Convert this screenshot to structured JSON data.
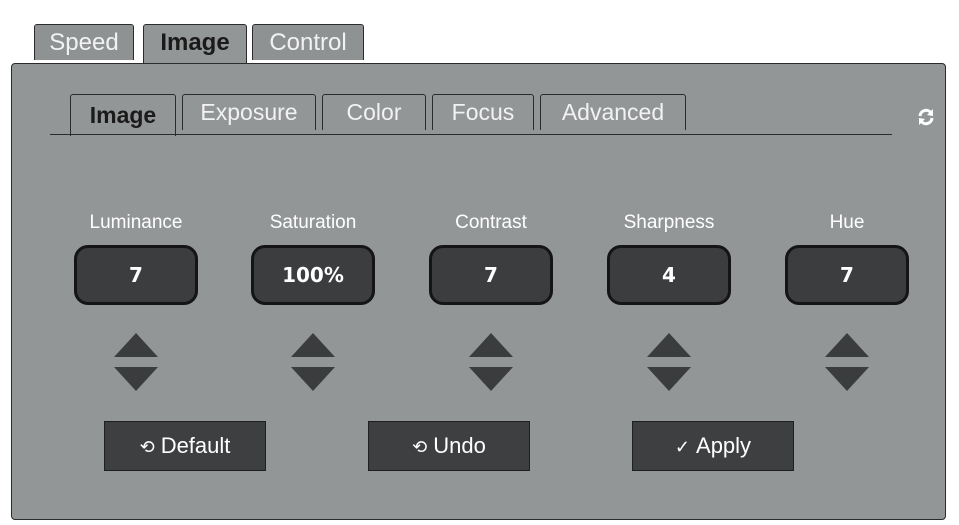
{
  "top_tabs": [
    {
      "label": "Speed",
      "active": false
    },
    {
      "label": "Image",
      "active": true
    },
    {
      "label": "Control",
      "active": false
    }
  ],
  "sub_tabs": [
    {
      "label": "Image",
      "active": true
    },
    {
      "label": "Exposure",
      "active": false
    },
    {
      "label": "Color",
      "active": false
    },
    {
      "label": "Focus",
      "active": false
    },
    {
      "label": "Advanced",
      "active": false
    }
  ],
  "refresh_icon": "refresh-icon",
  "controls": [
    {
      "label": "Luminance",
      "value": "7"
    },
    {
      "label": "Saturation",
      "value": "100%"
    },
    {
      "label": "Contrast",
      "value": "7"
    },
    {
      "label": "Sharpness",
      "value": "4"
    },
    {
      "label": "Hue",
      "value": "7"
    }
  ],
  "buttons": {
    "default_label": "Default",
    "undo_label": "Undo",
    "apply_label": "Apply"
  },
  "colors": {
    "panel_bg": "#939697",
    "value_bg": "#3b3d3f",
    "button_bg": "#3d3f41"
  }
}
